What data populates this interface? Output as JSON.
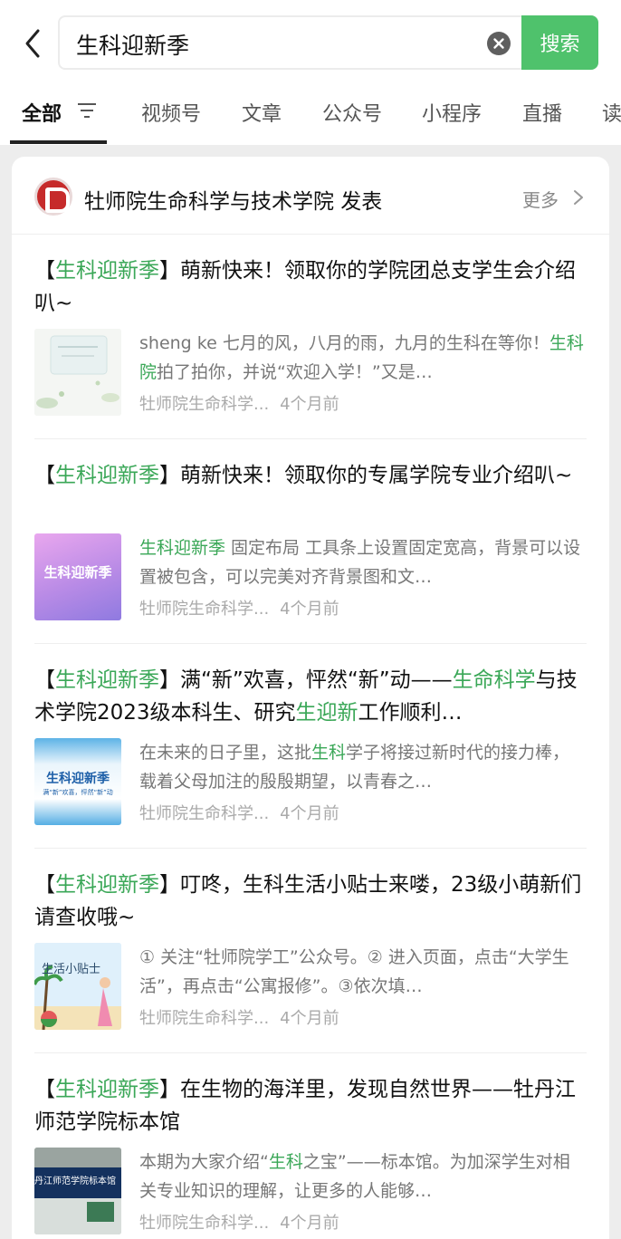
{
  "search": {
    "query": "生科迎新季",
    "button_label": "搜索"
  },
  "tabs": [
    {
      "label": "全部"
    },
    {
      "label": "视频号"
    },
    {
      "label": "文章"
    },
    {
      "label": "公众号"
    },
    {
      "label": "小程序"
    },
    {
      "label": "直播"
    },
    {
      "label": "读"
    }
  ],
  "account": {
    "name": "牡师院生命科学与技术学院 发表",
    "more_label": "更多"
  },
  "highlight_color": "#3aa757",
  "accent_color": "#4fc26c",
  "articles": [
    {
      "title": [
        {
          "text": "【",
          "hl": false
        },
        {
          "text": "生科迎新季",
          "hl": true
        },
        {
          "text": "】萌新快来！领取你的学院团总支学生会介绍叭~",
          "hl": false
        }
      ],
      "snippet": [
        {
          "text": "sheng ke 七月的风，八月的雨，九月的生科在等你！",
          "hl": false
        },
        {
          "text": "生科院",
          "hl": true
        },
        {
          "text": "拍了拍你，并说“欢迎入学！”又是…",
          "hl": false
        }
      ],
      "source": "牡师院生命科学...",
      "time": "4个月前"
    },
    {
      "title": [
        {
          "text": "【",
          "hl": false
        },
        {
          "text": "生科迎新季",
          "hl": true
        },
        {
          "text": "】萌新快来！领取你的专属学院专业介绍叭~",
          "hl": false
        }
      ],
      "snippet": [
        {
          "text": "生科迎新季",
          "hl": true
        },
        {
          "text": " 固定布局 工具条上设置固定宽高，背景可以设置被包含，可以完美对齐背景图和文…",
          "hl": false
        }
      ],
      "thumb_text": "生科迎新季",
      "source": "牡师院生命科学...",
      "time": "4个月前"
    },
    {
      "title": [
        {
          "text": "【",
          "hl": false
        },
        {
          "text": "生科迎新季",
          "hl": true
        },
        {
          "text": "】满“新”欢喜，怦然“新”动——",
          "hl": false
        },
        {
          "text": "生命科学",
          "hl": true
        },
        {
          "text": "与技术学院2023级本科生、研究",
          "hl": false
        },
        {
          "text": "生迎新",
          "hl": true
        },
        {
          "text": "工作顺利…",
          "hl": false
        }
      ],
      "snippet": [
        {
          "text": "在未来的日子里，这批",
          "hl": false
        },
        {
          "text": "生科",
          "hl": true
        },
        {
          "text": "学子将接过新时代的接力棒，载着父母加注的殷殷期望，以青春之…",
          "hl": false
        }
      ],
      "thumb_text": "生科迎新季",
      "thumb_subtext": "满“新”欢喜，怦然“新”动",
      "source": "牡师院生命科学...",
      "time": "4个月前"
    },
    {
      "title": [
        {
          "text": "【",
          "hl": false
        },
        {
          "text": "生科迎新季",
          "hl": true
        },
        {
          "text": "】叮咚，生科生活小贴士来喽，23级小萌新们请查收哦~",
          "hl": false
        }
      ],
      "snippet": [
        {
          "text": "① 关注“牡师院学工”公众号。② 进入页面，点击“大学生活”，再点击“公寓报修”。③依次填…",
          "hl": false
        }
      ],
      "thumb_text": "生活小贴士",
      "source": "牡师院生命科学...",
      "time": "4个月前"
    },
    {
      "title": [
        {
          "text": "【",
          "hl": false
        },
        {
          "text": "生科迎新季",
          "hl": true
        },
        {
          "text": "】在生物的海洋里，发现自然世界——牡丹江师范学院标本馆",
          "hl": false
        }
      ],
      "snippet": [
        {
          "text": "本期为大家介绍“",
          "hl": false
        },
        {
          "text": "生科",
          "hl": true
        },
        {
          "text": "之宝”——标本馆。为加深学生对相关专业知识的理解，让更多的人能够…",
          "hl": false
        }
      ],
      "thumb_text": "丹江师范学院标本馆",
      "source": "牡师院生命科学...",
      "time": "4个月前"
    }
  ]
}
